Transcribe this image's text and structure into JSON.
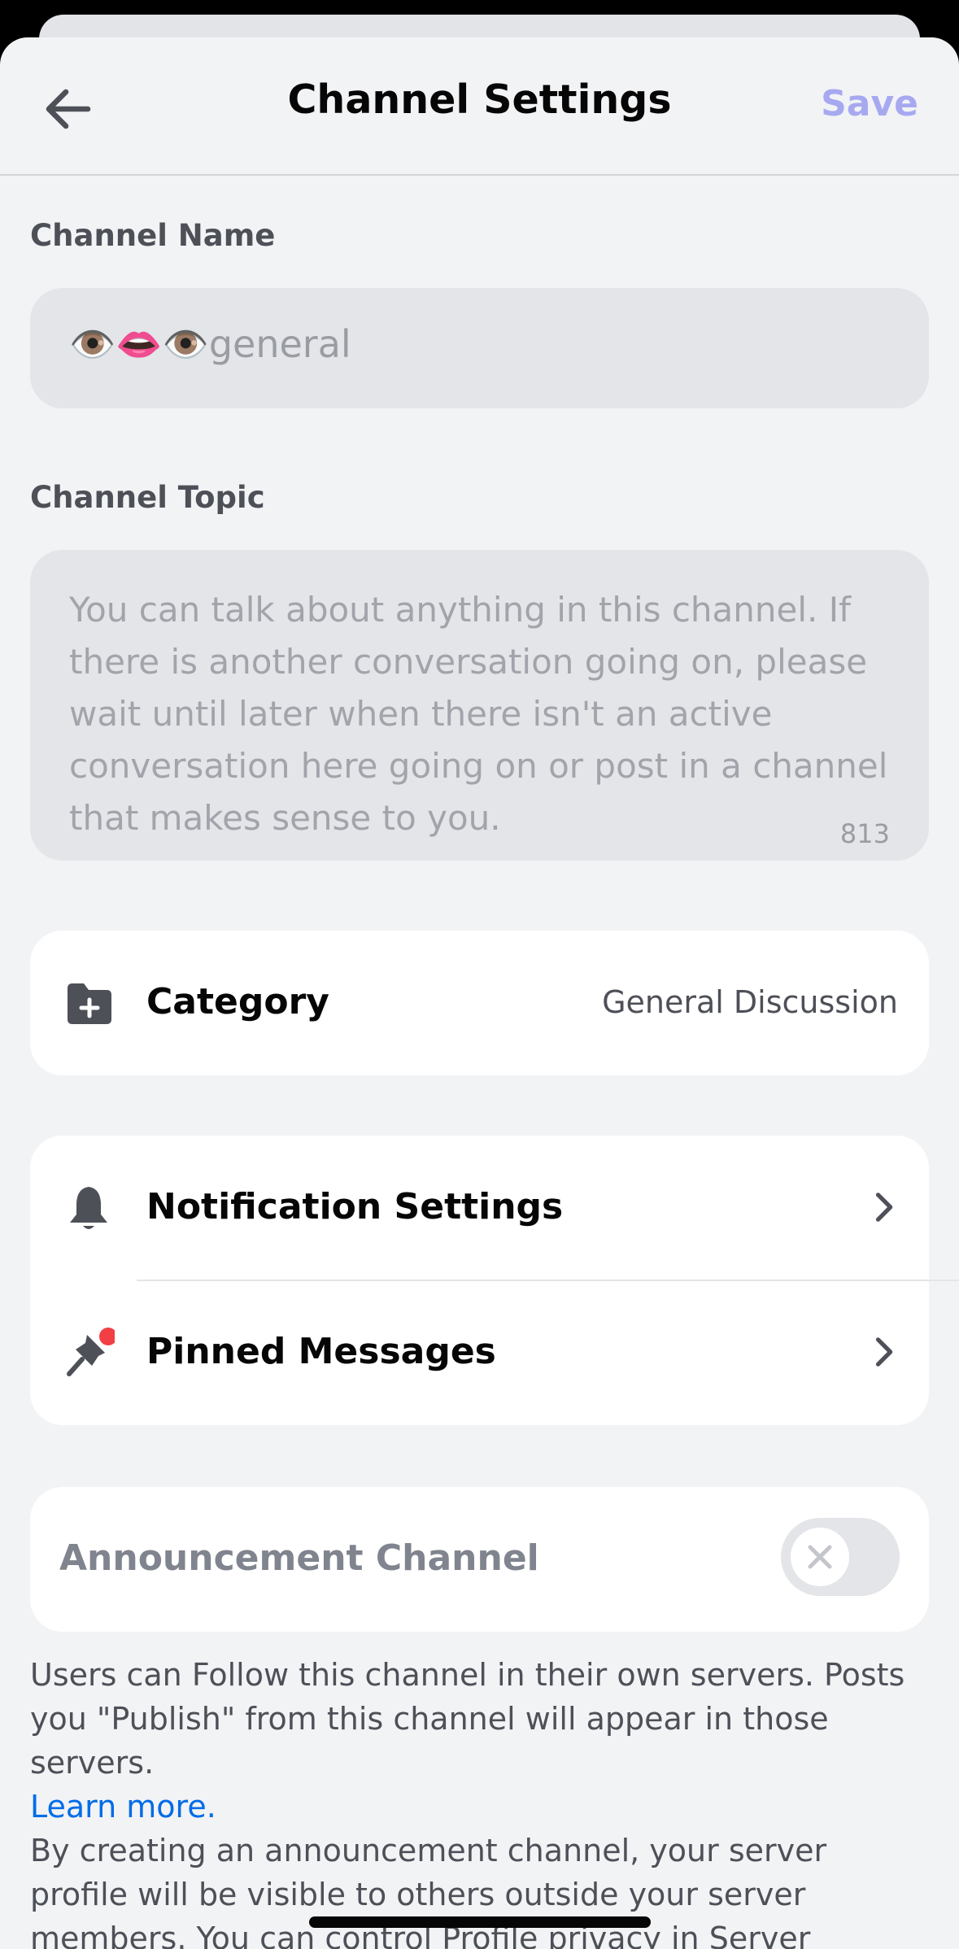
{
  "header": {
    "title": "Channel Settings",
    "save_label": "Save"
  },
  "channel_name": {
    "label": "Channel Name",
    "value": "👁️👄👁️general"
  },
  "channel_topic": {
    "label": "Channel Topic",
    "placeholder": "You can talk about anything in this channel. If there is another conversation going on, please wait until later when there isn't an active conversation here going on or post in a channel that makes sense to you.",
    "counter": "813"
  },
  "category": {
    "label": "Category",
    "value": "General Discussion",
    "icon": "folder-plus-icon"
  },
  "menu": {
    "notification_settings": {
      "label": "Notification Settings",
      "icon": "bell-icon"
    },
    "pinned_messages": {
      "label": "Pinned Messages",
      "icon": "pin-icon"
    }
  },
  "announcement": {
    "label": "Announcement Channel",
    "enabled": false,
    "description_1": "Users can Follow this channel in their own servers. Posts you \"Publish\" from this channel will appear in those servers.",
    "learn_more": "Learn more.",
    "description_2": "By creating an announcement channel, your server profile will be visible to others outside your server members. You can control Profile privacy in Server Settings > Profile."
  },
  "colors": {
    "background": "#f2f3f5",
    "card": "#ffffff",
    "save_disabled": "#a7a9f0",
    "link": "#006ce7",
    "notification_dot": "#f23f43"
  }
}
